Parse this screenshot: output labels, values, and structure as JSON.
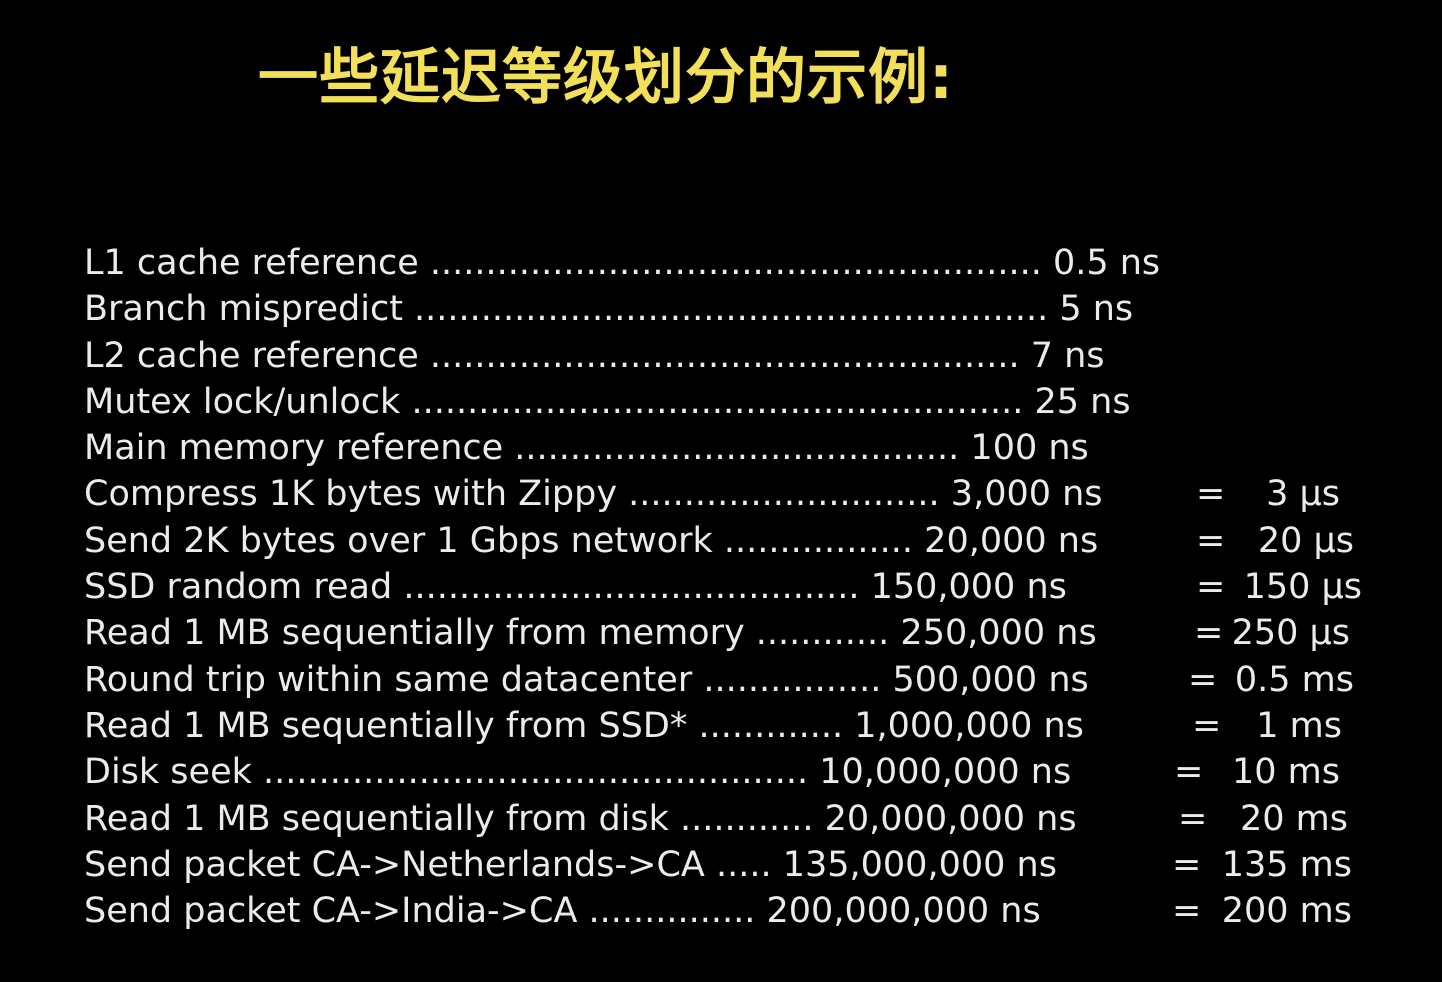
{
  "slide": {
    "title": "一些延迟等级划分的示例:",
    "colors": {
      "background": "#000000",
      "title": "#f3e05a",
      "text": "#ebebeb"
    },
    "rows": [
      {
        "label": "L1 cache reference ....................................................... 0.5 ns",
        "equals": "",
        "converted": ""
      },
      {
        "label": "Branch mispredict ......................................................... 5 ns",
        "equals": "",
        "converted": ""
      },
      {
        "label": "L2 cache reference ..................................................... 7 ns",
        "equals": "",
        "converted": ""
      },
      {
        "label": "Mutex lock/unlock ....................................................... 25 ns",
        "equals": "",
        "converted": ""
      },
      {
        "label": "Main memory reference ........................................ 100 ns",
        "equals": "",
        "converted": ""
      },
      {
        "label": "Compress 1K bytes with Zippy ............................ 3,000 ns",
        "equals": "=",
        "converted": "3 μs"
      },
      {
        "label": "Send 2K bytes over 1 Gbps network ................. 20,000 ns",
        "equals": "=",
        "converted": "20 μs"
      },
      {
        "label": "SSD random read ......................................... 150,000 ns",
        "equals": "=",
        "converted": "150 μs"
      },
      {
        "label": "Read 1 MB sequentially from memory ............ 250,000 ns",
        "equals": "=",
        "converted": "250 μs"
      },
      {
        "label": "Round trip within same datacenter ................ 500,000 ns",
        "equals": "=",
        "converted": "0.5 ms"
      },
      {
        "label": "Read 1 MB sequentially from SSD* ............. 1,000,000 ns",
        "equals": "=",
        "converted": "1 ms"
      },
      {
        "label": "Disk seek ................................................. 10,000,000 ns",
        "equals": "=",
        "converted": "10 ms"
      },
      {
        "label": "Read 1 MB sequentially from disk ............ 20,000,000 ns",
        "equals": "=",
        "converted": "20 ms"
      },
      {
        "label": "Send packet CA->Netherlands->CA ..... 135,000,000 ns",
        "equals": "=",
        "converted": "135 ms"
      },
      {
        "label": "Send packet CA->India->CA ............... 200,000,000 ns",
        "equals": "=",
        "converted": "200 ms"
      }
    ]
  }
}
